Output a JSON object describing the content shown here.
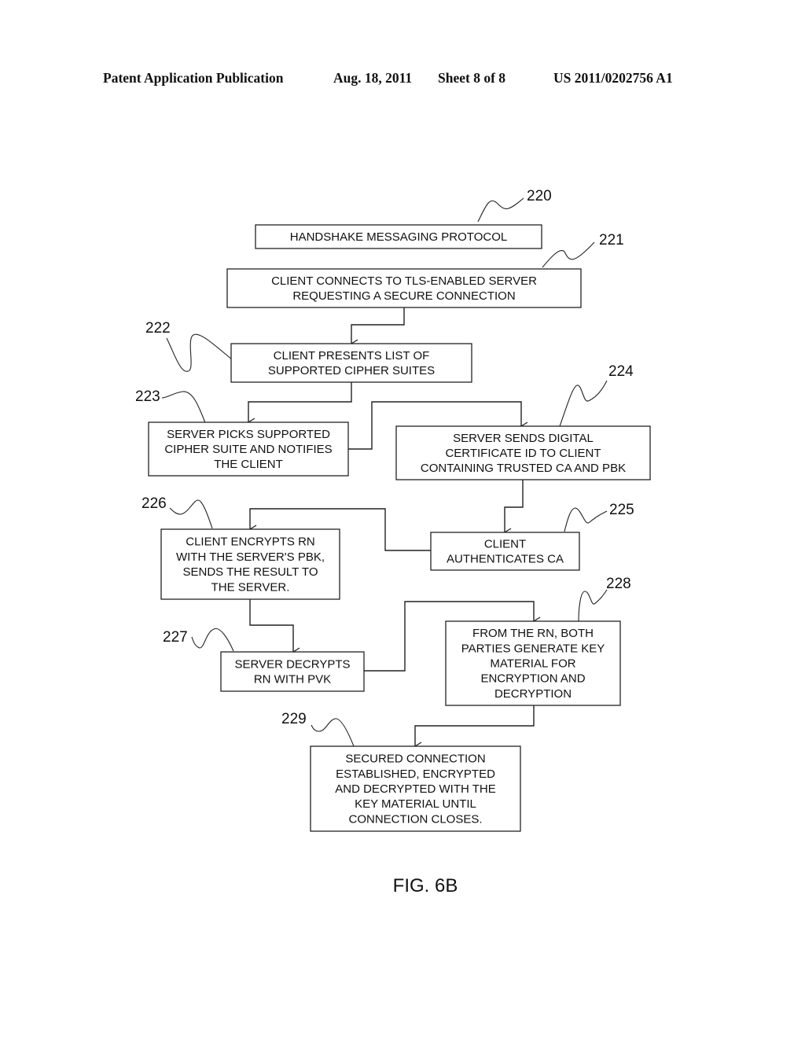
{
  "header": {
    "publication": "Patent Application Publication",
    "date": "Aug. 18, 2011",
    "sheet": "Sheet 8 of 8",
    "number": "US 2011/0202756 A1"
  },
  "diagram": {
    "figure_label": "FIG. 6B",
    "steps": [
      {
        "id": "220",
        "lines": [
          "HANDSHAKE MESSAGING PROTOCOL"
        ]
      },
      {
        "id": "221",
        "lines": [
          "CLIENT CONNECTS TO TLS-ENABLED SERVER",
          "REQUESTING A SECURE CONNECTION"
        ]
      },
      {
        "id": "222",
        "lines": [
          "CLIENT PRESENTS LIST OF",
          "SUPPORTED CIPHER SUITES"
        ]
      },
      {
        "id": "223",
        "lines": [
          "SERVER PICKS SUPPORTED",
          "CIPHER SUITE AND NOTIFIES",
          "THE CLIENT"
        ]
      },
      {
        "id": "224",
        "lines": [
          "SERVER SENDS DIGITAL",
          "CERTIFICATE ID TO CLIENT",
          "CONTAINING TRUSTED CA  AND PBK"
        ]
      },
      {
        "id": "225",
        "lines": [
          "CLIENT",
          "AUTHENTICATES CA"
        ]
      },
      {
        "id": "226",
        "lines": [
          "CLIENT ENCRYPTS RN",
          "WITH THE SERVER'S PBK,",
          "SENDS THE RESULT TO",
          "THE SERVER."
        ]
      },
      {
        "id": "227",
        "lines": [
          "SERVER DECRYPTS",
          "RN WITH PVK"
        ]
      },
      {
        "id": "228",
        "lines": [
          "FROM THE RN, BOTH",
          "PARTIES GENERATE KEY",
          "MATERIAL FOR",
          "ENCRYPTION AND",
          "DECRYPTION"
        ]
      },
      {
        "id": "229",
        "lines": [
          "SECURED CONNECTION",
          "ESTABLISHED, ENCRYPTED",
          "AND DECRYPTED WITH THE",
          "KEY MATERIAL UNTIL",
          "CONNECTION CLOSES."
        ]
      }
    ],
    "connections": [
      {
        "from": "221",
        "to": "222"
      },
      {
        "from": "222",
        "to": "223"
      },
      {
        "from": "223",
        "to": "224"
      },
      {
        "from": "224",
        "to": "225"
      },
      {
        "from": "225",
        "to": "226"
      },
      {
        "from": "226",
        "to": "227"
      },
      {
        "from": "227",
        "to": "228"
      },
      {
        "from": "228",
        "to": "229"
      }
    ]
  }
}
